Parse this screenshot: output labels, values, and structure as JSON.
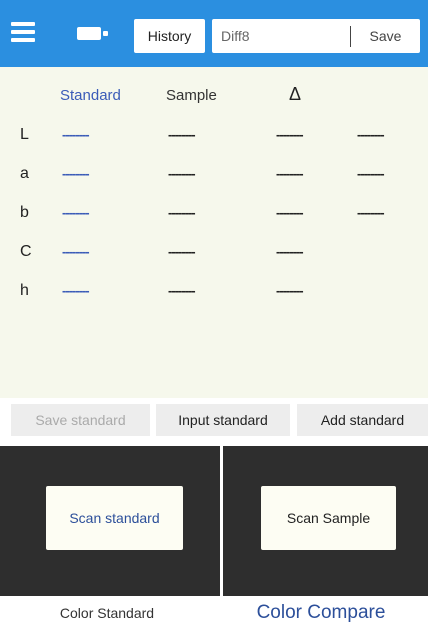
{
  "header": {
    "history_label": "History",
    "name_value": "Diff8",
    "save_label": "Save",
    "menu_icon": "menu-icon",
    "device_icon": "device-icon"
  },
  "table": {
    "columns": {
      "standard": "Standard",
      "sample": "Sample",
      "delta": "Δ"
    },
    "rows": [
      {
        "label": "L",
        "standard": "--------",
        "sample": "--------",
        "delta": "--------",
        "delta2": "--------"
      },
      {
        "label": "a",
        "standard": "--------",
        "sample": "--------",
        "delta": "--------",
        "delta2": "--------"
      },
      {
        "label": "b",
        "standard": "--------",
        "sample": "--------",
        "delta": "--------",
        "delta2": "--------"
      },
      {
        "label": "C",
        "standard": "--------",
        "sample": "--------",
        "delta": "--------"
      },
      {
        "label": "h",
        "standard": "--------",
        "sample": "--------",
        "delta": "--------"
      }
    ]
  },
  "actions": {
    "save_standard": "Save standard",
    "input_standard": "Input standard",
    "add_standard": "Add standard"
  },
  "scan": {
    "scan_standard": "Scan standard",
    "scan_sample": "Scan Sample"
  },
  "tabs": {
    "color_standard": "Color Standard",
    "color_compare": "Color Compare"
  },
  "colors": {
    "header_bg": "#2b8fe0",
    "panel_bg": "#f6f8ec",
    "standard_text": "#3a5bb8",
    "scan_area_bg": "#2e2e2e",
    "active_tab_text": "#2c4f9a"
  }
}
